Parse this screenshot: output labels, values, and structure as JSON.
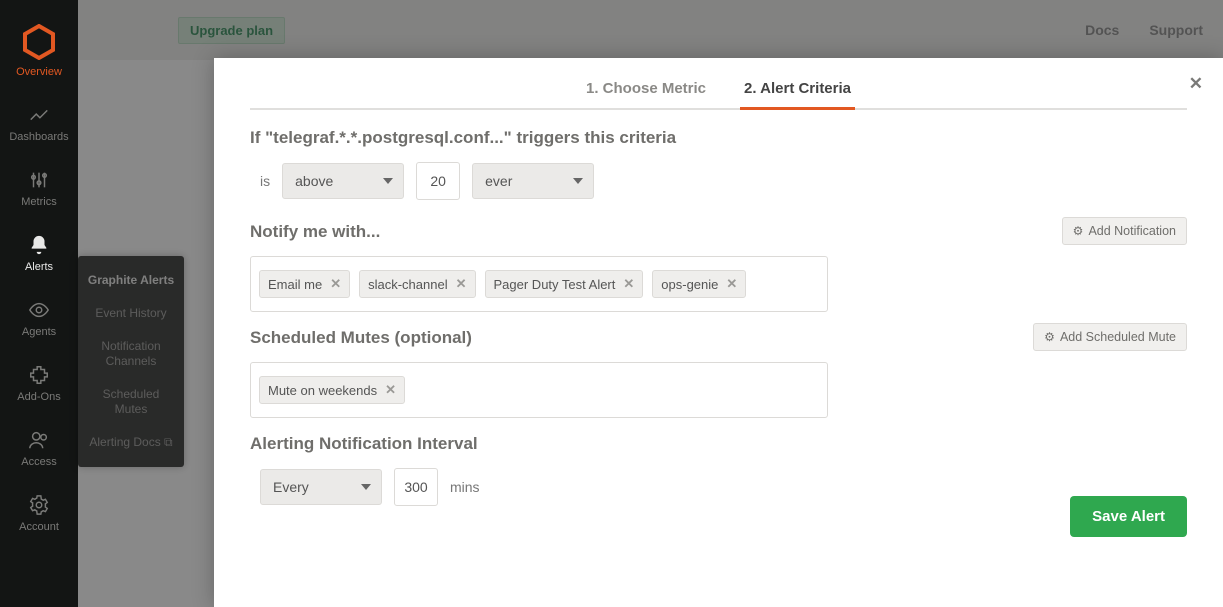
{
  "nav": {
    "logo_label": "Overview",
    "items": [
      {
        "label": "Overview"
      },
      {
        "label": "Dashboards"
      },
      {
        "label": "Metrics"
      },
      {
        "label": "Alerts"
      },
      {
        "label": "Agents"
      },
      {
        "label": "Add-Ons"
      },
      {
        "label": "Access"
      },
      {
        "label": "Account"
      }
    ]
  },
  "subnav": {
    "items": [
      {
        "label": "Graphite Alerts"
      },
      {
        "label": "Event History"
      },
      {
        "label": "Notification Channels"
      },
      {
        "label": "Scheduled Mutes"
      },
      {
        "label": "Alerting Docs ⧉"
      }
    ]
  },
  "topbar": {
    "upgrade": "Upgrade plan",
    "docs": "Docs",
    "support": "Support"
  },
  "modal": {
    "tabs": {
      "one": "1. Choose Metric",
      "two": "2. Alert Criteria"
    },
    "trigger_line": "If \"telegraf.*.*.postgresql.conf...\" triggers this criteria",
    "is_label": "is",
    "comparator": "above",
    "threshold": "20",
    "window": "ever",
    "notify_heading": "Notify me with...",
    "add_notification": "Add Notification",
    "notifications": [
      "Email me",
      "slack-channel",
      "Pager Duty Test Alert",
      "ops-genie"
    ],
    "mutes_heading": "Scheduled Mutes (optional)",
    "add_mute": "Add Scheduled Mute",
    "mutes": [
      "Mute on weekends"
    ],
    "interval_heading": "Alerting Notification Interval",
    "interval_mode": "Every",
    "interval_value": "300",
    "interval_unit": "mins",
    "save": "Save Alert"
  }
}
